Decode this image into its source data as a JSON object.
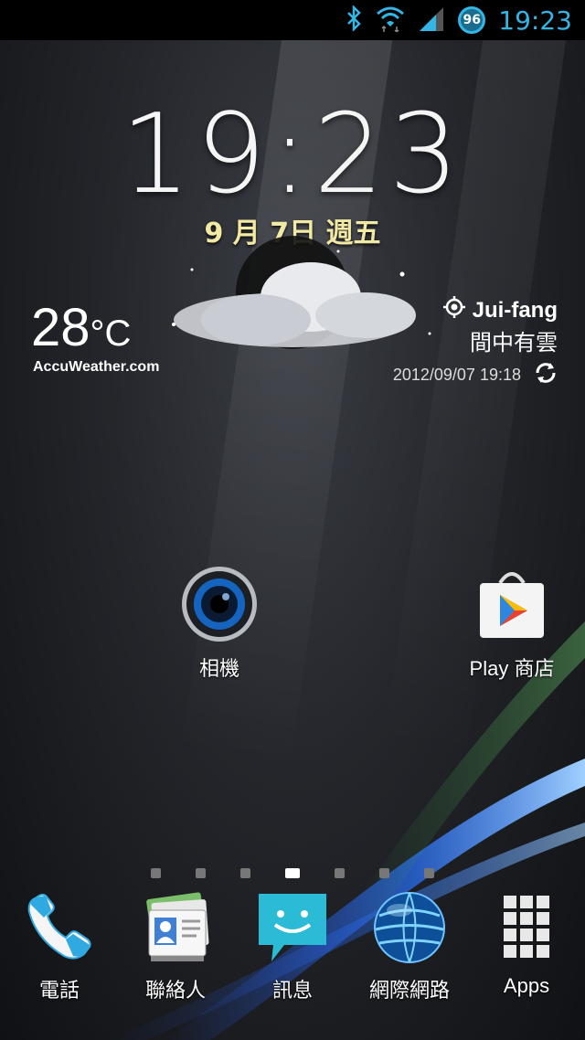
{
  "status_bar": {
    "time": "19:23",
    "battery": "96",
    "icons": [
      "bluetooth-icon",
      "wifi-icon",
      "signal-icon",
      "battery-icon"
    ],
    "accent": "#33b5e5"
  },
  "clock_widget": {
    "time": "19:23",
    "date": "9 月 7日 週五"
  },
  "weather_widget": {
    "temperature": "28",
    "unit": "°C",
    "provider": "AccuWeather.com",
    "location": "Jui-fang",
    "condition": "間中有雲",
    "updated": "2012/09/07 19:18",
    "icon": "partly-cloudy-night-icon"
  },
  "home_apps": [
    {
      "label": "相機",
      "icon": "camera-icon"
    },
    {
      "label": "Play 商店",
      "icon": "play-store-icon"
    }
  ],
  "pager": {
    "count": 7,
    "active": 3
  },
  "dock": [
    {
      "label": "電話",
      "icon": "phone-icon"
    },
    {
      "label": "聯絡人",
      "icon": "contacts-icon"
    },
    {
      "label": "訊息",
      "icon": "messages-icon"
    },
    {
      "label": "網際網路",
      "icon": "browser-icon"
    },
    {
      "label": "Apps",
      "icon": "apps-grid-icon"
    }
  ]
}
